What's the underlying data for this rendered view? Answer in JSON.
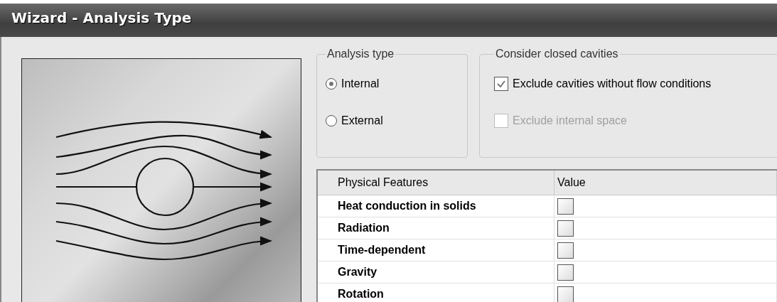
{
  "window": {
    "title": "Wizard - Analysis Type"
  },
  "analysis_type": {
    "label": "Analysis type",
    "options": [
      {
        "label": "Internal",
        "selected": true
      },
      {
        "label": "External",
        "selected": false
      }
    ]
  },
  "closed_cavities": {
    "label": "Consider closed cavities",
    "options": [
      {
        "label": "Exclude cavities without flow conditions",
        "checked": true,
        "disabled": false
      },
      {
        "label": "Exclude internal space",
        "checked": false,
        "disabled": true
      }
    ]
  },
  "table": {
    "columns": [
      "Physical Features",
      "Value"
    ],
    "rows": [
      {
        "feature": "Heat conduction in solids",
        "checked": false
      },
      {
        "feature": "Radiation",
        "checked": false
      },
      {
        "feature": "Time-dependent",
        "checked": false
      },
      {
        "feature": "Gravity",
        "checked": false
      },
      {
        "feature": "Rotation",
        "checked": false
      }
    ]
  }
}
